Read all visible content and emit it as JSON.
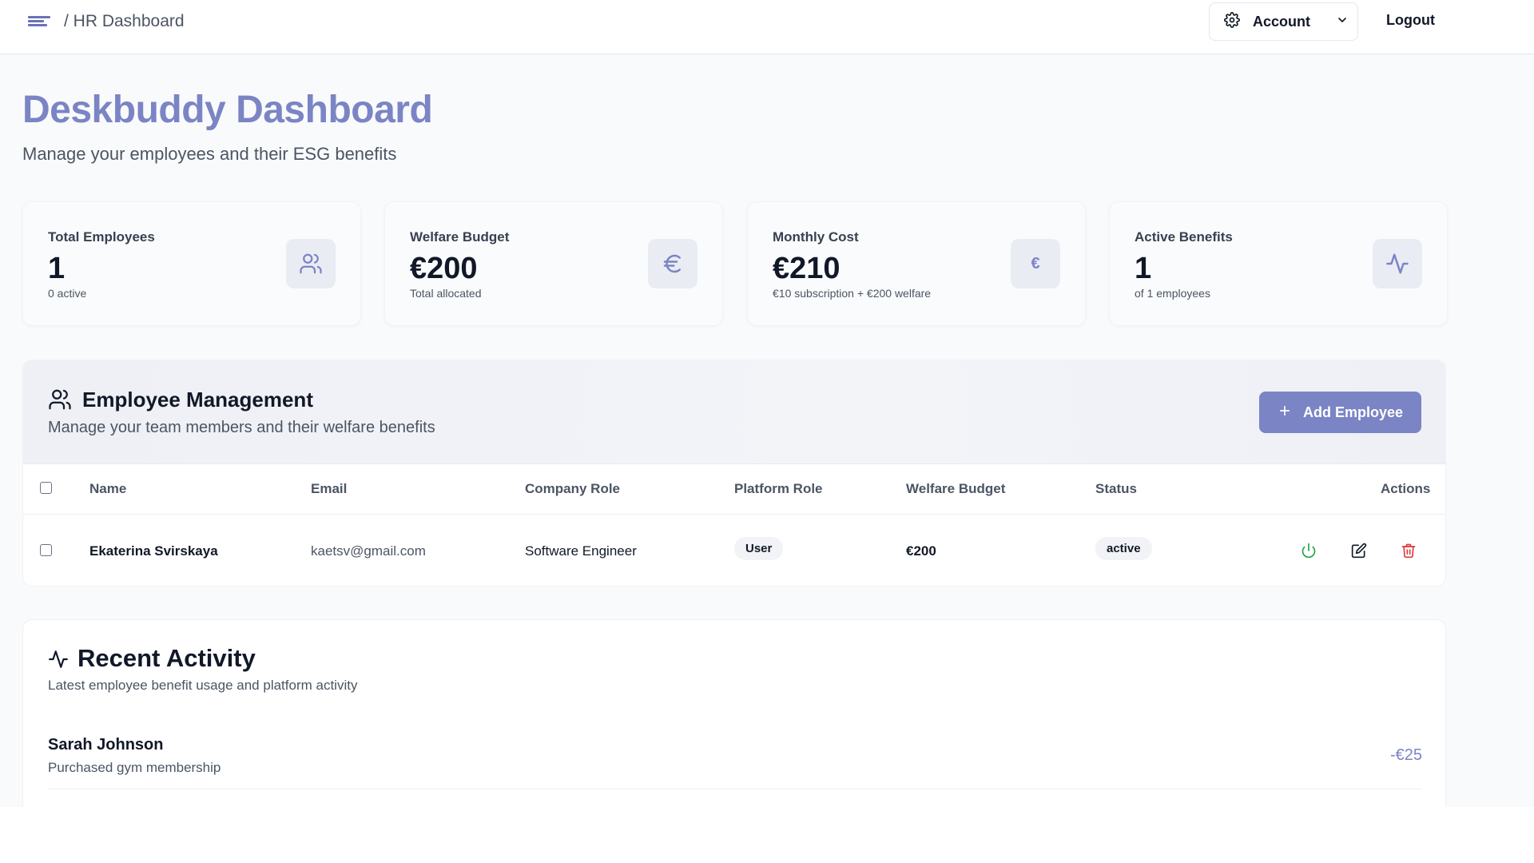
{
  "topbar": {
    "breadcrumb": "/ HR Dashboard",
    "account_label": "Account",
    "logout_label": "Logout"
  },
  "page": {
    "title": "Deskbuddy Dashboard",
    "subtitle": "Manage your employees and their ESG benefits"
  },
  "stats": [
    {
      "label": "Total Employees",
      "value": "1",
      "note": "0 active",
      "icon": "users-icon"
    },
    {
      "label": "Welfare Budget",
      "value": "€200",
      "note": "Total allocated",
      "icon": "euro-icon"
    },
    {
      "label": "Monthly Cost",
      "value": "€210",
      "note": "€10 subscription + €200 welfare",
      "icon": "euro-small-icon"
    },
    {
      "label": "Active Benefits",
      "value": "1",
      "note": "of 1 employees",
      "icon": "activity-icon"
    }
  ],
  "employees": {
    "title": "Employee Management",
    "subtitle": "Manage your team members and their welfare benefits",
    "add_label": "Add Employee",
    "columns": [
      "Name",
      "Email",
      "Company Role",
      "Platform Role",
      "Welfare Budget",
      "Status",
      "Actions"
    ],
    "rows": [
      {
        "name": "Ekaterina Svirskaya",
        "email": "kaetsv@gmail.com",
        "company_role": "Software Engineer",
        "platform_role": "User",
        "welfare_budget": "€200",
        "status": "active"
      }
    ]
  },
  "activity": {
    "title": "Recent Activity",
    "subtitle": "Latest employee benefit usage and platform activity",
    "items": [
      {
        "name": "Sarah Johnson",
        "description": "Purchased gym membership",
        "amount": "-€25"
      }
    ]
  },
  "colors": {
    "accent": "#7b84c4",
    "power_green": "#22a447",
    "delete_red": "#e0383e"
  }
}
